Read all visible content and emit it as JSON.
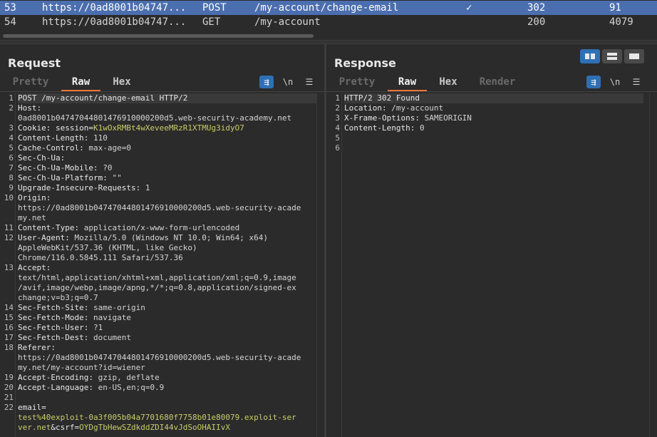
{
  "history": {
    "rows": [
      {
        "num": "53",
        "host": "https://0ad8001b04747...",
        "method": "POST",
        "url": "/my-account/change-email",
        "edited": "✓",
        "status": "302",
        "length": "91",
        "selected": true
      },
      {
        "num": "54",
        "host": "https://0ad8001b04747...",
        "method": "GET",
        "url": "/my-account",
        "edited": "",
        "status": "200",
        "length": "4079",
        "selected": false
      }
    ]
  },
  "request": {
    "title": "Request",
    "tabs": [
      "Pretty",
      "Raw",
      "Hex"
    ],
    "active_tab": "Raw",
    "tools": {
      "wrap": "⇶",
      "newline": "\\n",
      "menu": "☰"
    },
    "lines": [
      {
        "n": "1",
        "parts": [
          {
            "t": "POST /my-account/change-email HTTP/2",
            "c": "k"
          }
        ]
      },
      {
        "n": "2",
        "parts": [
          {
            "t": "Host: ",
            "c": "k"
          }
        ]
      },
      {
        "n": "",
        "parts": [
          {
            "t": "0ad8001b04747044801476910000200d5.web-security-academy.net",
            "c": "v"
          }
        ]
      },
      {
        "n": "3",
        "parts": [
          {
            "t": "Cookie: session=",
            "c": "k"
          },
          {
            "t": "K1wOxRMBt4wXeveeMRzR1XTMUg3idyO7",
            "c": "g"
          }
        ]
      },
      {
        "n": "4",
        "parts": [
          {
            "t": "Content-Length: ",
            "c": "k"
          },
          {
            "t": "110",
            "c": "v"
          }
        ]
      },
      {
        "n": "5",
        "parts": [
          {
            "t": "Cache-Control: ",
            "c": "k"
          },
          {
            "t": "max-age=0",
            "c": "v"
          }
        ]
      },
      {
        "n": "6",
        "parts": [
          {
            "t": "Sec-Ch-Ua: ",
            "c": "k"
          }
        ]
      },
      {
        "n": "7",
        "parts": [
          {
            "t": "Sec-Ch-Ua-Mobile: ",
            "c": "k"
          },
          {
            "t": "?0",
            "c": "v"
          }
        ]
      },
      {
        "n": "8",
        "parts": [
          {
            "t": "Sec-Ch-Ua-Platform: ",
            "c": "k"
          },
          {
            "t": "\"\"",
            "c": "v"
          }
        ]
      },
      {
        "n": "9",
        "parts": [
          {
            "t": "Upgrade-Insecure-Requests: ",
            "c": "k"
          },
          {
            "t": "1",
            "c": "v"
          }
        ]
      },
      {
        "n": "10",
        "parts": [
          {
            "t": "Origin: ",
            "c": "k"
          }
        ]
      },
      {
        "n": "",
        "parts": [
          {
            "t": "https://0ad8001b04747044801476910000200d5.web-security-acade",
            "c": "v"
          }
        ]
      },
      {
        "n": "",
        "parts": [
          {
            "t": "my.net",
            "c": "v"
          }
        ]
      },
      {
        "n": "11",
        "parts": [
          {
            "t": "Content-Type: ",
            "c": "k"
          },
          {
            "t": "application/x-www-form-urlencoded",
            "c": "v"
          }
        ]
      },
      {
        "n": "12",
        "parts": [
          {
            "t": "User-Agent: ",
            "c": "k"
          },
          {
            "t": "Mozilla/5.0 (Windows NT 10.0; Win64; x64)",
            "c": "v"
          }
        ]
      },
      {
        "n": "",
        "parts": [
          {
            "t": "AppleWebKit/537.36 (KHTML, like Gecko)",
            "c": "v"
          }
        ]
      },
      {
        "n": "",
        "parts": [
          {
            "t": "Chrome/116.0.5845.111 Safari/537.36",
            "c": "v"
          }
        ]
      },
      {
        "n": "13",
        "parts": [
          {
            "t": "Accept: ",
            "c": "k"
          }
        ]
      },
      {
        "n": "",
        "parts": [
          {
            "t": "text/html,application/xhtml+xml,application/xml;q=0.9,image",
            "c": "v"
          }
        ]
      },
      {
        "n": "",
        "parts": [
          {
            "t": "/avif,image/webp,image/apng,*/*;q=0.8,application/signed-ex",
            "c": "v"
          }
        ]
      },
      {
        "n": "",
        "parts": [
          {
            "t": "change;v=b3;q=0.7",
            "c": "v"
          }
        ]
      },
      {
        "n": "14",
        "parts": [
          {
            "t": "Sec-Fetch-Site: ",
            "c": "k"
          },
          {
            "t": "same-origin",
            "c": "v"
          }
        ]
      },
      {
        "n": "15",
        "parts": [
          {
            "t": "Sec-Fetch-Mode: ",
            "c": "k"
          },
          {
            "t": "navigate",
            "c": "v"
          }
        ]
      },
      {
        "n": "16",
        "parts": [
          {
            "t": "Sec-Fetch-User: ",
            "c": "k"
          },
          {
            "t": "?1",
            "c": "v"
          }
        ]
      },
      {
        "n": "17",
        "parts": [
          {
            "t": "Sec-Fetch-Dest: ",
            "c": "k"
          },
          {
            "t": "document",
            "c": "v"
          }
        ]
      },
      {
        "n": "18",
        "parts": [
          {
            "t": "Referer: ",
            "c": "k"
          }
        ]
      },
      {
        "n": "",
        "parts": [
          {
            "t": "https://0ad8001b04747044801476910000200d5.web-security-acade",
            "c": "v"
          }
        ]
      },
      {
        "n": "",
        "parts": [
          {
            "t": "my.net/my-account?id=wiener",
            "c": "v"
          }
        ]
      },
      {
        "n": "19",
        "parts": [
          {
            "t": "Accept-Encoding: ",
            "c": "k"
          },
          {
            "t": "gzip, deflate",
            "c": "v"
          }
        ]
      },
      {
        "n": "20",
        "parts": [
          {
            "t": "Accept-Language: ",
            "c": "k"
          },
          {
            "t": "en-US,en;q=0.9",
            "c": "v"
          }
        ]
      },
      {
        "n": "21",
        "parts": []
      },
      {
        "n": "22",
        "parts": [
          {
            "t": "email=",
            "c": "k"
          }
        ]
      },
      {
        "n": "",
        "parts": [
          {
            "t": "test%40exploit-0a3f005b04a7701680f7758b01e80079.exploit-ser",
            "c": "g"
          }
        ]
      },
      {
        "n": "",
        "parts": [
          {
            "t": "ver.net",
            "c": "g"
          },
          {
            "t": "&csrf=",
            "c": "k"
          },
          {
            "t": "OYDgTbHewSZdkddZDI44vJdSoOHAIIvX",
            "c": "g"
          }
        ]
      }
    ]
  },
  "response": {
    "title": "Response",
    "tabs": [
      "Pretty",
      "Raw",
      "Hex",
      "Render"
    ],
    "active_tab": "Raw",
    "tools": {
      "wrap": "⇶",
      "newline": "\\n",
      "menu": "☰"
    },
    "lines": [
      {
        "n": "1",
        "parts": [
          {
            "t": "HTTP/2 302 Found",
            "c": "k"
          }
        ]
      },
      {
        "n": "2",
        "parts": [
          {
            "t": "Location: ",
            "c": "k"
          },
          {
            "t": "/my-account",
            "c": "v"
          }
        ]
      },
      {
        "n": "3",
        "parts": [
          {
            "t": "X-Frame-Options: ",
            "c": "k"
          },
          {
            "t": "SAMEORIGIN",
            "c": "v"
          }
        ]
      },
      {
        "n": "4",
        "parts": [
          {
            "t": "Content-Length: ",
            "c": "k"
          },
          {
            "t": "0",
            "c": "v"
          }
        ]
      },
      {
        "n": "5",
        "parts": []
      },
      {
        "n": "6",
        "parts": []
      }
    ]
  },
  "colors": {
    "accent": "#e8733a",
    "selection": "#4b6eaf",
    "toggle_on": "#2f6fb3",
    "param_value": "#c8cd6a"
  }
}
